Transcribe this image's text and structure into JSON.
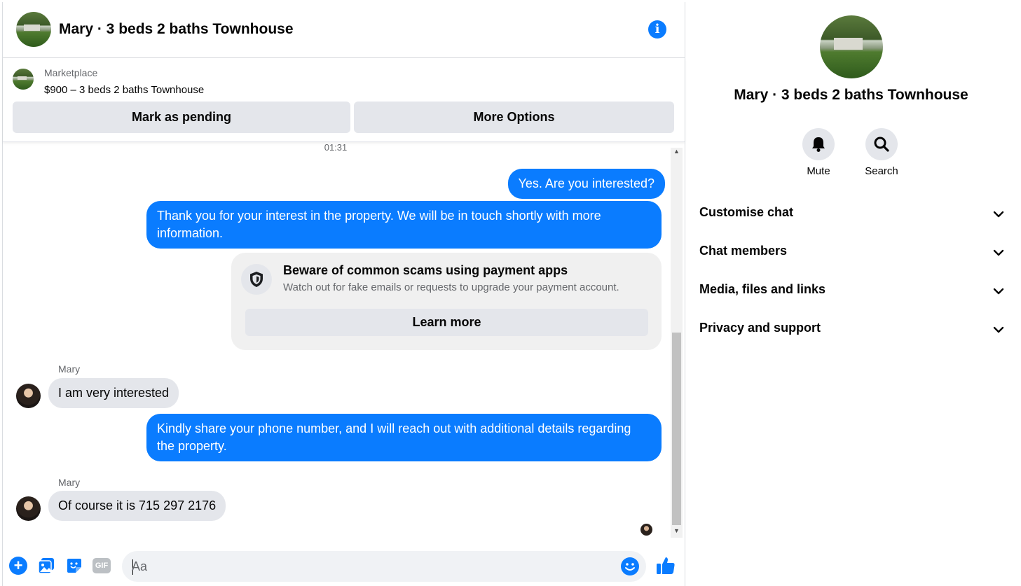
{
  "conversation": {
    "title": "Mary · 3 beds 2 baths Townhouse",
    "info_icon_glyph": "i",
    "marketplace": {
      "label": "Marketplace",
      "listing": "$900 – 3 beds 2 baths Townhouse",
      "mark_pending_label": "Mark as pending",
      "more_options_label": "More Options"
    },
    "timestamp": "01:31",
    "messages": {
      "out_1": "Yes. Are you interested?",
      "out_2": "Thank you for your interest in the property. We will be in touch shortly with more information.",
      "scam_title": "Beware of common scams using payment apps",
      "scam_desc": "Watch out for fake emails or requests to upgrade your payment account.",
      "learn_more": "Learn more",
      "sender_1": "Mary",
      "in_1": "I am very interested",
      "out_3": "Kindly share your phone number, and I will reach out with additional details regarding the property.",
      "sender_2": "Mary",
      "in_2": "Of course it is 715 297 2176"
    },
    "composer": {
      "placeholder": "Aa",
      "gif_label": "GIF",
      "plus_glyph": "+"
    }
  },
  "info_panel": {
    "title": "Mary · 3 beds 2 baths Townhouse",
    "actions": {
      "mute": "Mute",
      "search": "Search"
    },
    "sections": [
      "Customise chat",
      "Chat members",
      "Media, files and links",
      "Privacy and support"
    ]
  },
  "colors": {
    "accent": "#0a7cff",
    "bubble_in": "#e4e6eb",
    "secondary_text": "#65676b"
  },
  "icons": [
    "info-icon",
    "shield-icon",
    "plus-icon",
    "photo-icon",
    "sticker-icon",
    "gif-icon",
    "emoji-icon",
    "like-icon",
    "bell-icon",
    "search-icon",
    "chevron-down-icon"
  ]
}
